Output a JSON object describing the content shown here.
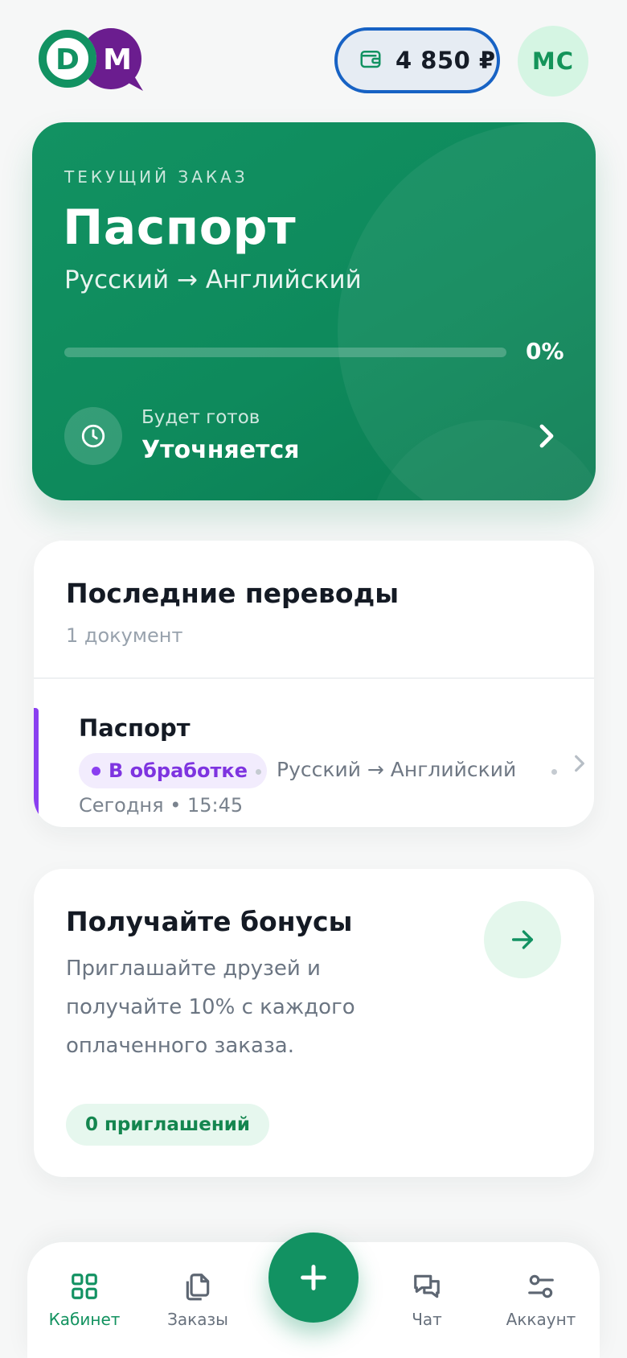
{
  "header": {
    "logo_letters": [
      "D",
      "M"
    ],
    "wallet_amount": "4 850 ₽",
    "avatar_initials": "МС"
  },
  "current_order": {
    "eyebrow": "ТЕКУЩИЙ ЗАКАЗ",
    "title": "Паспорт",
    "languages": "Русский → Английский",
    "progress_percent": 0,
    "progress_label": "0%",
    "ready_label": "Будет готов",
    "ready_value": "Уточняется"
  },
  "recent": {
    "title": "Последние переводы",
    "subtitle": "1 документ",
    "items": [
      {
        "name": "Паспорт",
        "status": "В обработке",
        "languages": "Русский → Английский",
        "date": "Сегодня",
        "time": "15:45"
      }
    ]
  },
  "bonus": {
    "title": "Получайте бонусы",
    "description": "Приглашайте друзей и получайте 10% с каждого оплаченного заказа.",
    "invites": "0 приглашений"
  },
  "nav": {
    "items": [
      {
        "label": "Кабинет",
        "icon": "grid-icon",
        "active": true
      },
      {
        "label": "Заказы",
        "icon": "documents-icon",
        "active": false
      },
      {
        "label": "Чат",
        "icon": "chat-icon",
        "active": false
      },
      {
        "label": "Аккаунт",
        "icon": "sliders-icon",
        "active": false
      }
    ],
    "fab_icon": "plus-icon"
  },
  "colors": {
    "brand_green": "#129262",
    "wallet_border": "#1762c4",
    "status_purple": "#8a3ff0",
    "logo_purple": "#6b1d8f"
  }
}
